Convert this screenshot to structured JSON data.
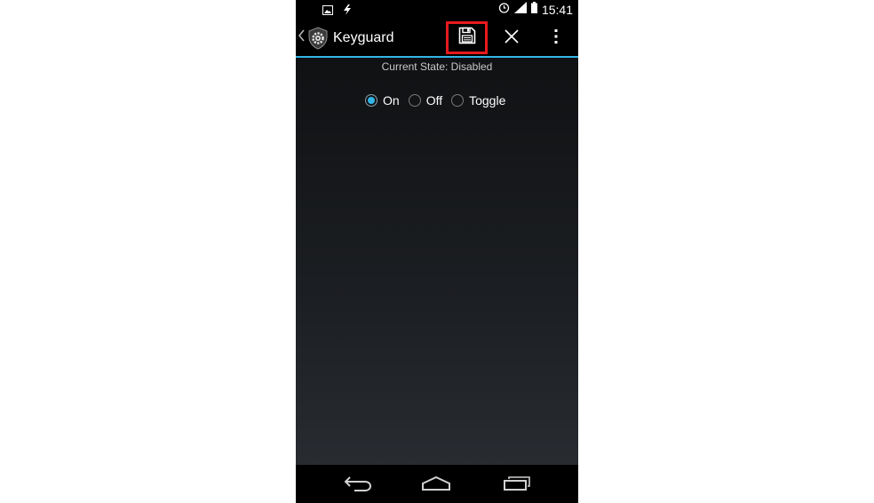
{
  "status_bar": {
    "time": "15:41",
    "left_icons": [
      "image-notification-icon",
      "charging-bolt-icon"
    ],
    "right_icons": [
      "alarm-icon",
      "signal-icon",
      "battery-icon"
    ]
  },
  "action_bar": {
    "title": "Keyguard",
    "actions": [
      "save-icon",
      "close-icon",
      "overflow-menu-icon"
    ],
    "accent_color": "#33b5e5",
    "highlight_color": "#e8191d"
  },
  "content": {
    "current_state": "Current State: Disabled",
    "radio_options": [
      {
        "label": "On",
        "checked": true
      },
      {
        "label": "Off",
        "checked": false
      },
      {
        "label": "Toggle",
        "checked": false
      }
    ]
  },
  "nav_bar": {
    "buttons": [
      "back-icon",
      "home-icon",
      "recent-apps-icon"
    ]
  }
}
